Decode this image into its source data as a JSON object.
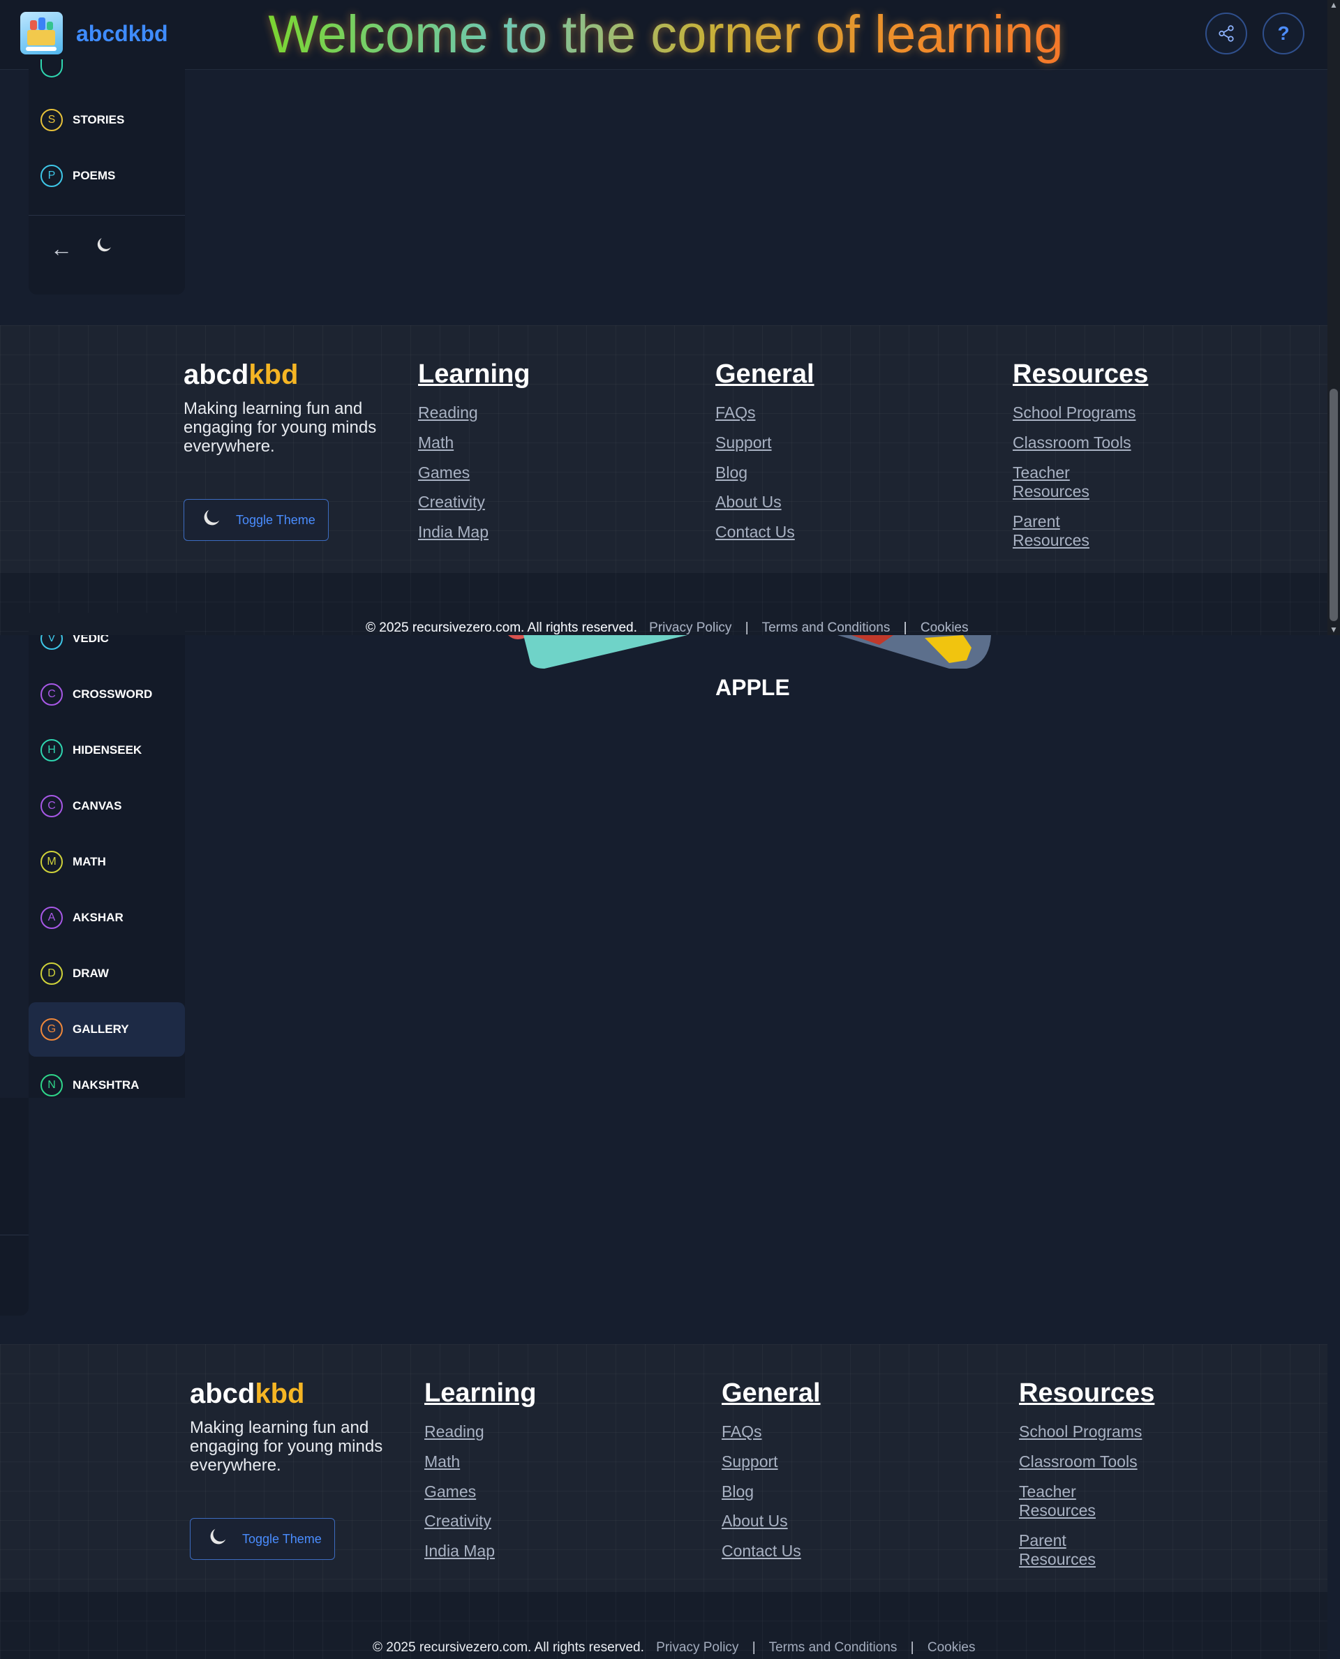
{
  "header": {
    "brand": "abcdkbd",
    "welcome": "Welcome to the corner of learning",
    "help_label": "?"
  },
  "sidebar_top": {
    "items": [
      {
        "badge": "S",
        "label": "STORIES",
        "color": "#e8c23a"
      },
      {
        "badge": "P",
        "label": "POEMS",
        "color": "#3ec7e8"
      }
    ]
  },
  "sidebar_bottom": {
    "items": [
      {
        "badge": "V",
        "label": "VEDIC",
        "color": "#3ec7e8"
      },
      {
        "badge": "C",
        "label": "CROSSWORD",
        "color": "#a758e6"
      },
      {
        "badge": "H",
        "label": "HIDENSEEK",
        "color": "#2fd6b0"
      },
      {
        "badge": "C",
        "label": "CANVAS",
        "color": "#a758e6"
      },
      {
        "badge": "M",
        "label": "MATH",
        "color": "#cfd23a"
      },
      {
        "badge": "A",
        "label": "AKSHAR",
        "color": "#a758e6"
      },
      {
        "badge": "D",
        "label": "DRAW",
        "color": "#cfd23a"
      },
      {
        "badge": "G",
        "label": "GALLERY",
        "color": "#f0883a",
        "active": true
      },
      {
        "badge": "N",
        "label": "NAKSHTRA",
        "color": "#2fd68a"
      }
    ]
  },
  "main": {
    "card_label": "APPLE"
  },
  "footer": {
    "brand_main": "abcd",
    "brand_accent": "kbd",
    "description": "Making learning fun and engaging for young minds everywhere.",
    "toggle_label": "Toggle Theme",
    "columns": [
      {
        "heading": "Learning",
        "links": [
          "Reading",
          "Math",
          "Games",
          "Creativity",
          "India Map"
        ]
      },
      {
        "heading": "General",
        "links": [
          "FAQs",
          "Support",
          "Blog",
          "About Us",
          "Contact Us"
        ]
      },
      {
        "heading": "Resources",
        "links": [
          "School Programs",
          "Classroom Tools",
          "Teacher Resources",
          "Parent Resources"
        ]
      }
    ],
    "copyright": "© 2025 recursivezero.com. All rights reserved.",
    "legal_links": [
      "Privacy Policy",
      "Terms and Conditions",
      "Cookies"
    ],
    "separator": "|"
  }
}
